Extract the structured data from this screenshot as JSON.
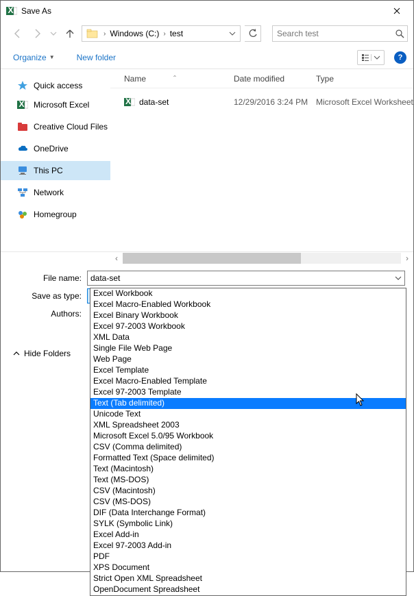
{
  "titlebar": {
    "title": "Save As"
  },
  "nav": {
    "breadcrumbs": [
      "Windows  (C:)",
      "test"
    ],
    "search_placeholder": "Search test"
  },
  "toolbar": {
    "organize": "Organize",
    "new_folder": "New folder"
  },
  "sidebar": {
    "items": [
      {
        "label": "Quick access",
        "icon": "star"
      },
      {
        "label": "Microsoft Excel",
        "icon": "excel"
      },
      {
        "label": "Creative Cloud Files",
        "icon": "cc"
      },
      {
        "label": "OneDrive",
        "icon": "onedrive"
      },
      {
        "label": "This PC",
        "icon": "pc",
        "selected": true
      },
      {
        "label": "Network",
        "icon": "network"
      },
      {
        "label": "Homegroup",
        "icon": "homegroup"
      }
    ]
  },
  "list": {
    "headers": {
      "name": "Name",
      "date": "Date modified",
      "type": "Type"
    },
    "rows": [
      {
        "name": "data-set",
        "date": "12/29/2016 3:24 PM",
        "type": "Microsoft Excel Worksheet"
      }
    ]
  },
  "form": {
    "file_name_label": "File name:",
    "file_name_value": "data-set",
    "save_type_label": "Save as type:",
    "save_type_value": "Excel Workbook",
    "authors_label": "Authors:",
    "hide_folders": "Hide Folders"
  },
  "dropdown": {
    "selected_index": 10,
    "options": [
      "Excel Workbook",
      "Excel Macro-Enabled Workbook",
      "Excel Binary Workbook",
      "Excel 97-2003 Workbook",
      "XML Data",
      "Single File Web Page",
      "Web Page",
      "Excel Template",
      "Excel Macro-Enabled Template",
      "Excel 97-2003 Template",
      "Text (Tab delimited)",
      "Unicode Text",
      "XML Spreadsheet 2003",
      "Microsoft Excel 5.0/95 Workbook",
      "CSV (Comma delimited)",
      "Formatted Text (Space delimited)",
      "Text (Macintosh)",
      "Text (MS-DOS)",
      "CSV (Macintosh)",
      "CSV (MS-DOS)",
      "DIF (Data Interchange Format)",
      "SYLK (Symbolic Link)",
      "Excel Add-in",
      "Excel 97-2003 Add-in",
      "PDF",
      "XPS Document",
      "Strict Open XML Spreadsheet",
      "OpenDocument Spreadsheet"
    ]
  }
}
